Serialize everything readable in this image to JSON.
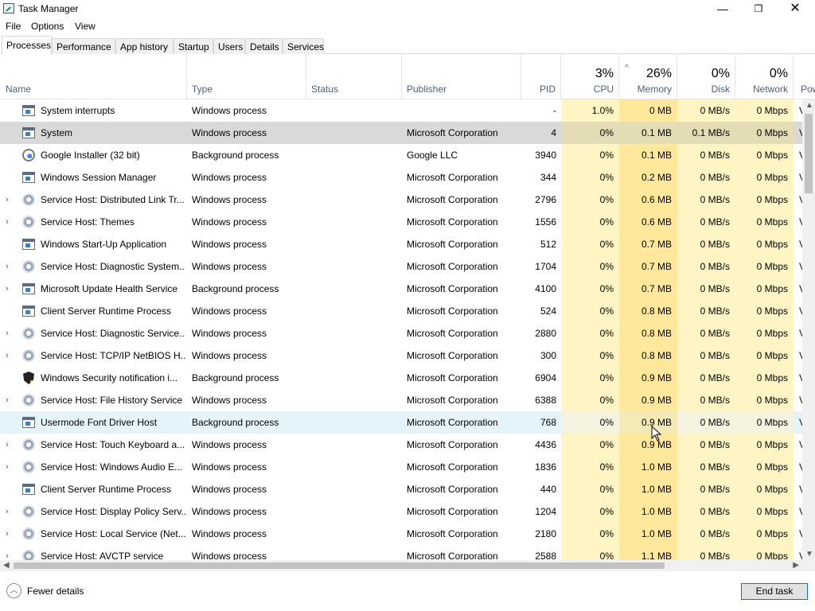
{
  "window": {
    "title": "Task Manager",
    "minimize": "—",
    "maximize": "❐",
    "close": "✕"
  },
  "menu": [
    "File",
    "Options",
    "View"
  ],
  "tabs": [
    "Processes",
    "Performance",
    "App history",
    "Startup",
    "Users",
    "Details",
    "Services"
  ],
  "active_tab": "Processes",
  "columns": {
    "name": "Name",
    "type": "Type",
    "status": "Status",
    "publisher": "Publisher",
    "pid": "PID",
    "cpu": "CPU",
    "cpu_pct": "3%",
    "memory": "Memory",
    "memory_pct": "26%",
    "disk": "Disk",
    "disk_pct": "0%",
    "network": "Network",
    "network_pct": "0%",
    "power": "Pow"
  },
  "colors": {
    "cpu_bg": "#fff4c4",
    "memory_bg": "#ffe89b",
    "selected_row": "#d9d9d9",
    "hover_row": "#e5f3fb",
    "header_text": "#4c607a",
    "accent": "#0078d7"
  },
  "processes": [
    {
      "name": "System interrupts",
      "type": "Windows process",
      "publisher": "",
      "pid": "-",
      "cpu": "1.0%",
      "memory": "0 MB",
      "disk": "0 MB/s",
      "network": "0 Mbps",
      "power": "V",
      "icon": "window-icon",
      "expandable": false
    },
    {
      "name": "System",
      "type": "Windows process",
      "publisher": "Microsoft Corporation",
      "pid": "4",
      "cpu": "0%",
      "memory": "0.1 MB",
      "disk": "0.1 MB/s",
      "network": "0 Mbps",
      "power": "V",
      "icon": "window-icon",
      "expandable": false,
      "state": "selected"
    },
    {
      "name": "Google Installer (32 bit)",
      "type": "Background process",
      "publisher": "Google LLC",
      "pid": "3940",
      "cpu": "0%",
      "memory": "0.1 MB",
      "disk": "0 MB/s",
      "network": "0 Mbps",
      "power": "V",
      "icon": "google-icon",
      "expandable": false
    },
    {
      "name": "Windows Session Manager",
      "type": "Windows process",
      "publisher": "Microsoft Corporation",
      "pid": "344",
      "cpu": "0%",
      "memory": "0.2 MB",
      "disk": "0 MB/s",
      "network": "0 Mbps",
      "power": "V",
      "icon": "window-icon",
      "expandable": false
    },
    {
      "name": "Service Host: Distributed Link Tr...",
      "type": "Windows process",
      "publisher": "Microsoft Corporation",
      "pid": "2796",
      "cpu": "0%",
      "memory": "0.6 MB",
      "disk": "0 MB/s",
      "network": "0 Mbps",
      "power": "V",
      "icon": "gear-icon",
      "expandable": true
    },
    {
      "name": "Service Host: Themes",
      "type": "Windows process",
      "publisher": "Microsoft Corporation",
      "pid": "1556",
      "cpu": "0%",
      "memory": "0.6 MB",
      "disk": "0 MB/s",
      "network": "0 Mbps",
      "power": "V",
      "icon": "gear-icon",
      "expandable": true
    },
    {
      "name": "Windows Start-Up Application",
      "type": "Windows process",
      "publisher": "Microsoft Corporation",
      "pid": "512",
      "cpu": "0%",
      "memory": "0.7 MB",
      "disk": "0 MB/s",
      "network": "0 Mbps",
      "power": "V",
      "icon": "window-icon",
      "expandable": false
    },
    {
      "name": "Service Host: Diagnostic System...",
      "type": "Windows process",
      "publisher": "Microsoft Corporation",
      "pid": "1704",
      "cpu": "0%",
      "memory": "0.7 MB",
      "disk": "0 MB/s",
      "network": "0 Mbps",
      "power": "V",
      "icon": "gear-icon",
      "expandable": true
    },
    {
      "name": "Microsoft Update Health Service",
      "type": "Background process",
      "publisher": "Microsoft Corporation",
      "pid": "4100",
      "cpu": "0%",
      "memory": "0.7 MB",
      "disk": "0 MB/s",
      "network": "0 Mbps",
      "power": "V",
      "icon": "window-icon",
      "expandable": true
    },
    {
      "name": "Client Server Runtime Process",
      "type": "Windows process",
      "publisher": "Microsoft Corporation",
      "pid": "524",
      "cpu": "0%",
      "memory": "0.8 MB",
      "disk": "0 MB/s",
      "network": "0 Mbps",
      "power": "V",
      "icon": "window-icon",
      "expandable": false
    },
    {
      "name": "Service Host: Diagnostic Service...",
      "type": "Windows process",
      "publisher": "Microsoft Corporation",
      "pid": "2880",
      "cpu": "0%",
      "memory": "0.8 MB",
      "disk": "0 MB/s",
      "network": "0 Mbps",
      "power": "V",
      "icon": "gear-icon",
      "expandable": true
    },
    {
      "name": "Service Host: TCP/IP NetBIOS H...",
      "type": "Windows process",
      "publisher": "Microsoft Corporation",
      "pid": "300",
      "cpu": "0%",
      "memory": "0.8 MB",
      "disk": "0 MB/s",
      "network": "0 Mbps",
      "power": "V",
      "icon": "gear-icon",
      "expandable": true
    },
    {
      "name": "Windows Security notification i...",
      "type": "Background process",
      "publisher": "Microsoft Corporation",
      "pid": "6904",
      "cpu": "0%",
      "memory": "0.9 MB",
      "disk": "0 MB/s",
      "network": "0 Mbps",
      "power": "V",
      "icon": "shield-icon",
      "expandable": false
    },
    {
      "name": "Service Host: File History Service",
      "type": "Windows process",
      "publisher": "Microsoft Corporation",
      "pid": "6388",
      "cpu": "0%",
      "memory": "0.9 MB",
      "disk": "0 MB/s",
      "network": "0 Mbps",
      "power": "V",
      "icon": "gear-icon",
      "expandable": true
    },
    {
      "name": "Usermode Font Driver Host",
      "type": "Background process",
      "publisher": "Microsoft Corporation",
      "pid": "768",
      "cpu": "0%",
      "memory": "0.9 MB",
      "disk": "0 MB/s",
      "network": "0 Mbps",
      "power": "V",
      "icon": "window-icon",
      "expandable": false,
      "state": "hover"
    },
    {
      "name": "Service Host: Touch Keyboard a...",
      "type": "Windows process",
      "publisher": "Microsoft Corporation",
      "pid": "4436",
      "cpu": "0%",
      "memory": "0.9 MB",
      "disk": "0 MB/s",
      "network": "0 Mbps",
      "power": "V",
      "icon": "gear-icon",
      "expandable": true
    },
    {
      "name": "Service Host: Windows Audio E...",
      "type": "Windows process",
      "publisher": "Microsoft Corporation",
      "pid": "1836",
      "cpu": "0%",
      "memory": "1.0 MB",
      "disk": "0 MB/s",
      "network": "0 Mbps",
      "power": "V",
      "icon": "gear-icon",
      "expandable": true
    },
    {
      "name": "Client Server Runtime Process",
      "type": "Windows process",
      "publisher": "Microsoft Corporation",
      "pid": "440",
      "cpu": "0%",
      "memory": "1.0 MB",
      "disk": "0 MB/s",
      "network": "0 Mbps",
      "power": "V",
      "icon": "window-icon",
      "expandable": false
    },
    {
      "name": "Service Host: Display Policy Serv...",
      "type": "Windows process",
      "publisher": "Microsoft Corporation",
      "pid": "1204",
      "cpu": "0%",
      "memory": "1.0 MB",
      "disk": "0 MB/s",
      "network": "0 Mbps",
      "power": "V",
      "icon": "gear-icon",
      "expandable": true
    },
    {
      "name": "Service Host: Local Service (Net...",
      "type": "Windows process",
      "publisher": "Microsoft Corporation",
      "pid": "2180",
      "cpu": "0%",
      "memory": "1.0 MB",
      "disk": "0 MB/s",
      "network": "0 Mbps",
      "power": "V",
      "icon": "gear-icon",
      "expandable": true
    },
    {
      "name": "Service Host: AVCTP service",
      "type": "Windows process",
      "publisher": "Microsoft Corporation",
      "pid": "2588",
      "cpu": "0%",
      "memory": "1.1 MB",
      "disk": "0 MB/s",
      "network": "0 Mbps",
      "power": "V",
      "icon": "gear-icon",
      "expandable": true
    }
  ],
  "footer": {
    "fewer_details": "Fewer details",
    "end_task": "End task"
  }
}
